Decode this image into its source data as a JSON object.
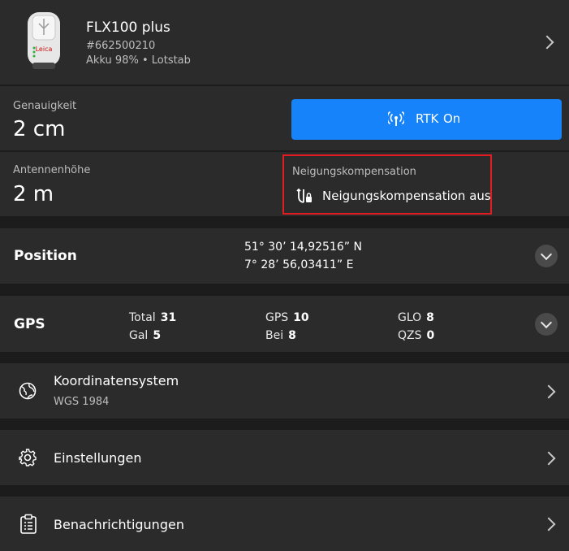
{
  "device": {
    "name": "FLX100 plus",
    "serial": "#662500210",
    "status": "Akku 98% • Lotstab"
  },
  "accuracy": {
    "label": "Genauigkeit",
    "value": "2 cm"
  },
  "rtk": {
    "label": "RTK",
    "state": "On",
    "color": "#1683fb"
  },
  "antenna": {
    "label": "Antennenhöhe",
    "value": "2 m"
  },
  "tilt": {
    "label": "Neigungskompensation",
    "value": "Neigungskompensation aus",
    "highlight_color": "#e31b23"
  },
  "position": {
    "title": "Position",
    "lat": "51° 30’ 14,92516” N",
    "lon": "7° 28’ 56,03411” E"
  },
  "gps": {
    "title": "GPS",
    "stats": [
      {
        "key": "Total",
        "value": "31"
      },
      {
        "key": "GPS",
        "value": "10"
      },
      {
        "key": "GLO",
        "value": "8"
      },
      {
        "key": "Gal",
        "value": "5"
      },
      {
        "key": "Bei",
        "value": "8"
      },
      {
        "key": "QZS",
        "value": "0"
      }
    ]
  },
  "menu": [
    {
      "label": "Koordinatensystem",
      "sub": "WGS 1984",
      "icon": "globe-icon"
    },
    {
      "label": "Einstellungen",
      "icon": "gear-icon"
    },
    {
      "label": "Benachrichtigungen",
      "icon": "clipboard-icon"
    }
  ]
}
